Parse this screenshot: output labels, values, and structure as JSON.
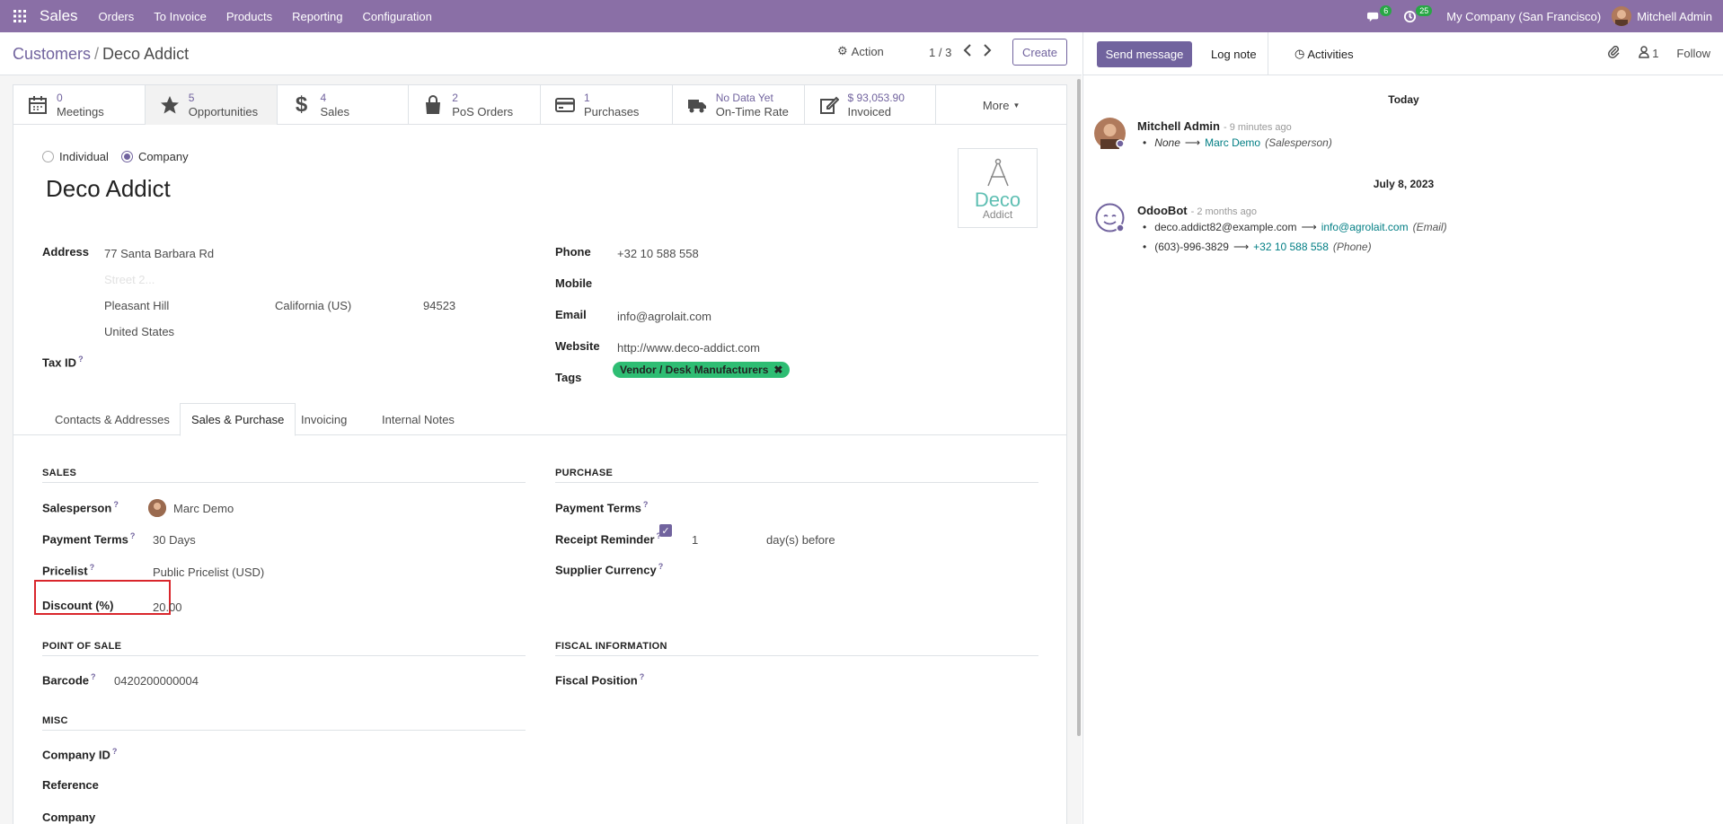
{
  "navbar": {
    "app_name": "Sales",
    "menu": [
      "Orders",
      "To Invoice",
      "Products",
      "Reporting",
      "Configuration"
    ],
    "messages_count": "6",
    "activities_count": "25",
    "company": "My Company (San Francisco)",
    "user": "Mitchell Admin",
    "bar_color": "#8a6fa6"
  },
  "control_panel": {
    "breadcrumb_parent": "Customers",
    "breadcrumb_separator": "/",
    "breadcrumb_current": "Deco Addict",
    "action_label": "Action",
    "pager": "1 / 3",
    "create_label": "Create"
  },
  "smart_buttons": [
    {
      "value": "0",
      "label": "Meetings",
      "icon": "calendar-icon"
    },
    {
      "value": "5",
      "label": "Opportunities",
      "icon": "star-icon"
    },
    {
      "value": "4",
      "label": "Sales",
      "icon": "dollar-icon"
    },
    {
      "value": "2",
      "label": "PoS Orders",
      "icon": "shopping-bag-icon"
    },
    {
      "value": "1",
      "label": "Purchases",
      "icon": "credit-card-icon"
    },
    {
      "value": "No Data Yet",
      "label": "On-Time Rate",
      "icon": "truck-icon"
    },
    {
      "value": "$ 93,053.90",
      "label": "Invoiced",
      "icon": "edit-icon"
    }
  ],
  "more_label": "More",
  "partner": {
    "type_individual": "Individual",
    "type_company": "Company",
    "name": "Deco Addict",
    "logo_line1": "Deco",
    "logo_line2": "Addict"
  },
  "address": {
    "label": "Address",
    "street": "77 Santa Barbara Rd",
    "street2_placeholder": "Street 2...",
    "city": "Pleasant Hill",
    "state": "California (US)",
    "zip": "94523",
    "country": "United States"
  },
  "tax_id_label": "Tax ID",
  "contact": {
    "phone_label": "Phone",
    "phone": "+32 10 588 558",
    "mobile_label": "Mobile",
    "email_label": "Email",
    "email": "info@agrolait.com",
    "website_label": "Website",
    "website": "http://www.deco-addict.com",
    "tags_label": "Tags",
    "tag": "Vendor / Desk Manufacturers"
  },
  "tabs": [
    "Contacts & Addresses",
    "Sales & Purchase",
    "Invoicing",
    "Internal Notes"
  ],
  "sales": {
    "title": "SALES",
    "salesperson_label": "Salesperson",
    "salesperson": "Marc Demo",
    "payment_terms_label": "Payment Terms",
    "payment_terms": "30 Days",
    "pricelist_label": "Pricelist",
    "pricelist": "Public Pricelist (USD)",
    "discount_label": "Discount (%)",
    "discount": "20.00"
  },
  "purchase": {
    "title": "PURCHASE",
    "payment_terms_label": "Payment Terms",
    "receipt_reminder_label": "Receipt Reminder",
    "receipt_days": "1",
    "receipt_suffix": "day(s) before",
    "supplier_currency_label": "Supplier Currency"
  },
  "pos": {
    "title": "POINT OF SALE",
    "barcode_label": "Barcode",
    "barcode": "0420200000004"
  },
  "fiscal": {
    "title": "FISCAL INFORMATION",
    "fiscal_position_label": "Fiscal Position"
  },
  "misc": {
    "title": "MISC",
    "company_id_label": "Company ID",
    "reference_label": "Reference",
    "company_label": "Company"
  },
  "chatter": {
    "send_message": "Send message",
    "log_note": "Log note",
    "activities": "Activities",
    "followers_count": "1",
    "follow": "Follow",
    "date_today": "Today",
    "msg1_author": "Mitchell Admin",
    "msg1_date": "- 9 minutes ago",
    "msg1_old": "None",
    "msg1_new": "Marc Demo",
    "msg1_field": "(Salesperson)",
    "date_old": "July 8, 2023",
    "msg2_author": "OdooBot",
    "msg2_date": "- 2 months ago",
    "msg2_line1_old": "deco.addict82@example.com",
    "msg2_line1_new": "info@agrolait.com",
    "msg2_line1_field": "(Email)",
    "msg2_line2_old": "(603)-996-3829",
    "msg2_line2_new": "+32 10 588 558",
    "msg2_line2_field": "(Phone)"
  }
}
